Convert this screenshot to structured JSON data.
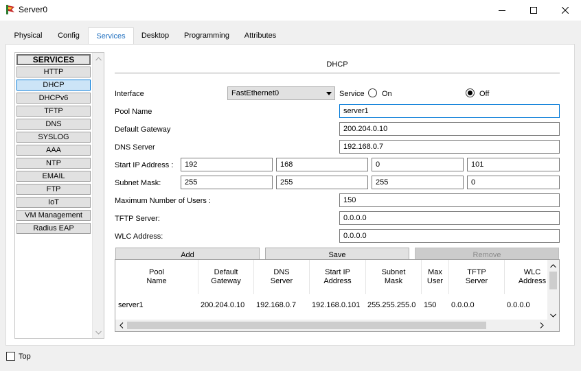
{
  "window": {
    "title": "Server0"
  },
  "tabs": [
    {
      "label": "Physical"
    },
    {
      "label": "Config"
    },
    {
      "label": "Services",
      "active": true
    },
    {
      "label": "Desktop"
    },
    {
      "label": "Programming"
    },
    {
      "label": "Attributes"
    }
  ],
  "sidebar": {
    "header": "SERVICES",
    "items": [
      "HTTP",
      "DHCP",
      "DHCPv6",
      "TFTP",
      "DNS",
      "SYSLOG",
      "AAA",
      "NTP",
      "EMAIL",
      "FTP",
      "IoT",
      "VM Management",
      "Radius EAP"
    ],
    "selected": "DHCP"
  },
  "dhcp": {
    "section_title": "DHCP",
    "interface_label": "Interface",
    "interface_value": "FastEthernet0",
    "service_label": "Service",
    "on_label": "On",
    "off_label": "Off",
    "service_state": "Off",
    "pool_name_label": "Pool Name",
    "pool_name_value": "server1",
    "default_gateway_label": "Default Gateway",
    "default_gateway_value": "200.204.0.10",
    "dns_server_label": "DNS Server",
    "dns_server_value": "192.168.0.7",
    "start_ip_label": "Start IP Address :",
    "start_ip": [
      "192",
      "168",
      "0",
      "101"
    ],
    "subnet_mask_label": "Subnet Mask:",
    "subnet_mask": [
      "255",
      "255",
      "255",
      "0"
    ],
    "max_users_label": "Maximum Number of Users :",
    "max_users_value": "150",
    "tftp_server_label": "TFTP Server:",
    "tftp_server_value": "0.0.0.0",
    "wlc_address_label": "WLC Address:",
    "wlc_address_value": "0.0.0.0",
    "add_label": "Add",
    "save_label": "Save",
    "remove_label": "Remove"
  },
  "pool_table": {
    "columns": [
      "Pool Name",
      "Default Gateway",
      "DNS Server",
      "Start IP Address",
      "Subnet Mask",
      "Max User",
      "TFTP Server",
      "WLC Address"
    ],
    "rows": [
      [
        "server1",
        "200.204.0.10",
        "192.168.0.7",
        "192.168.0.101",
        "255.255.255.0",
        "150",
        "0.0.0.0",
        "0.0.0.0"
      ]
    ]
  },
  "footer": {
    "top_label": "Top",
    "top_checked": false
  },
  "colors": {
    "accent": "#0078d7",
    "tab_active_text": "#1f6fbf",
    "selected_item_bg": "#cce4f7"
  }
}
